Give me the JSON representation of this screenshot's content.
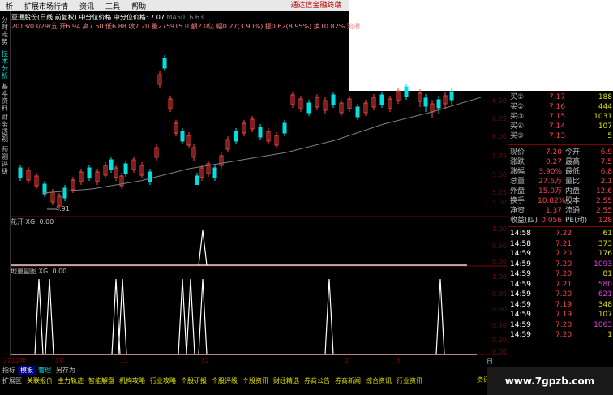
{
  "menu": {
    "items": [
      "析",
      "扩展市场行情",
      "资讯",
      "工具",
      "帮助"
    ],
    "brand": "通达信金融终端"
  },
  "side_tabs": [
    "分时走势",
    "技术分析",
    "基本资料",
    "财务透视",
    "预测评级"
  ],
  "stock": {
    "title": "亚通股份(日线 前复权)",
    "title_extra": "中分位价格 中分位价格: 7.07",
    "ma": "MA50: 6.63",
    "info": "2013/03/29/五 开6.94 高7.50 低6.88 收7.20 量275915.0 额2.0亿 幅0.27(3.90%) 振0.62(8.95%) 换10.82% 流通"
  },
  "chart_labels": {
    "low_mark": "4.91",
    "price_ticks": [
      "6.50",
      "6.25",
      "6.00",
      "5.75",
      "5.50",
      "5.25",
      "5.00"
    ],
    "panel2_title": "花开 XG: 0.00",
    "panel2_ticks": [
      "1.00",
      "0.50",
      "0.00"
    ],
    "panel3_title": "地量副图 XG: 0.00",
    "panel3_ticks": [
      "1.00",
      "0.80",
      "0.60",
      "0.40",
      "0.20",
      "0.00"
    ],
    "x_ticks": [
      "2012年",
      "10",
      "11",
      "12",
      "2",
      "3"
    ]
  },
  "quote": {
    "asks": [
      {
        "label": "买①",
        "price": "7.17",
        "vol": "188"
      },
      {
        "label": "买②",
        "price": "7.16",
        "vol": "444"
      },
      {
        "label": "买③",
        "price": "7.15",
        "vol": "1031"
      },
      {
        "label": "买④",
        "price": "7.14",
        "vol": "107"
      },
      {
        "label": "买⑤",
        "price": "7.13",
        "vol": "5"
      }
    ],
    "stats": [
      {
        "k1": "现价",
        "v1": "7.20",
        "k2": "今开",
        "v2": "6.9"
      },
      {
        "k1": "涨跌",
        "v1": "0.27",
        "k2": "最高",
        "v2": "7.5"
      },
      {
        "k1": "涨幅",
        "v1": "3.90%",
        "k2": "最低",
        "v2": "6.8"
      },
      {
        "k1": "总量",
        "v1": "27.6万",
        "k2": "量比",
        "v2": "2.1"
      },
      {
        "k1": "外盘",
        "v1": "15.0万",
        "k2": "内盘",
        "v2": "12.6"
      },
      {
        "k1": "换手",
        "v1": "10.82%",
        "k2": "股本",
        "v2": "2.55"
      },
      {
        "k1": "净资",
        "v1": "1.37",
        "k2": "流通",
        "v2": "2.55"
      },
      {
        "k1": "收益(四)",
        "v1": "0.056",
        "k2": "PE(动)",
        "v2": "128"
      }
    ],
    "ticks": [
      {
        "t": "14:58",
        "p": "7.22",
        "v": "61"
      },
      {
        "t": "14:58",
        "p": "7.21",
        "v": "373"
      },
      {
        "t": "14:59",
        "p": "7.20",
        "v": "176"
      },
      {
        "t": "14:59",
        "p": "7.20",
        "v": "1093"
      },
      {
        "t": "14:59",
        "p": "7.20",
        "v": "81"
      },
      {
        "t": "14:59",
        "p": "7.21",
        "v": "580"
      },
      {
        "t": "14:59",
        "p": "7.20",
        "v": "621"
      },
      {
        "t": "14:59",
        "p": "7.19",
        "v": "348"
      },
      {
        "t": "14:59",
        "p": "7.19",
        "v": "107"
      },
      {
        "t": "14:59",
        "p": "7.20",
        "v": "1063"
      },
      {
        "t": "14:59",
        "p": "7.20",
        "v": "1"
      }
    ]
  },
  "bottom_tabs": [
    "指标",
    "模板",
    "管理",
    "另存为"
  ],
  "bottom_nav": [
    "扩展区",
    "关联报价",
    "主力轨迹",
    "智能解盘",
    "机构攻略",
    "行业攻略",
    "个股研报",
    "个股评级",
    "个股资讯",
    "财经精选",
    "券商公告",
    "券商新闻",
    "综合资讯",
    "行业资讯"
  ],
  "bottom_right": "资讯",
  "day_label": "日",
  "watermark": "www.7gpzb.com",
  "colors": {
    "up": "#ff4040",
    "down": "#00e0e0",
    "ma": "#808080",
    "grid": "#800000",
    "white": "#ffffff"
  }
}
